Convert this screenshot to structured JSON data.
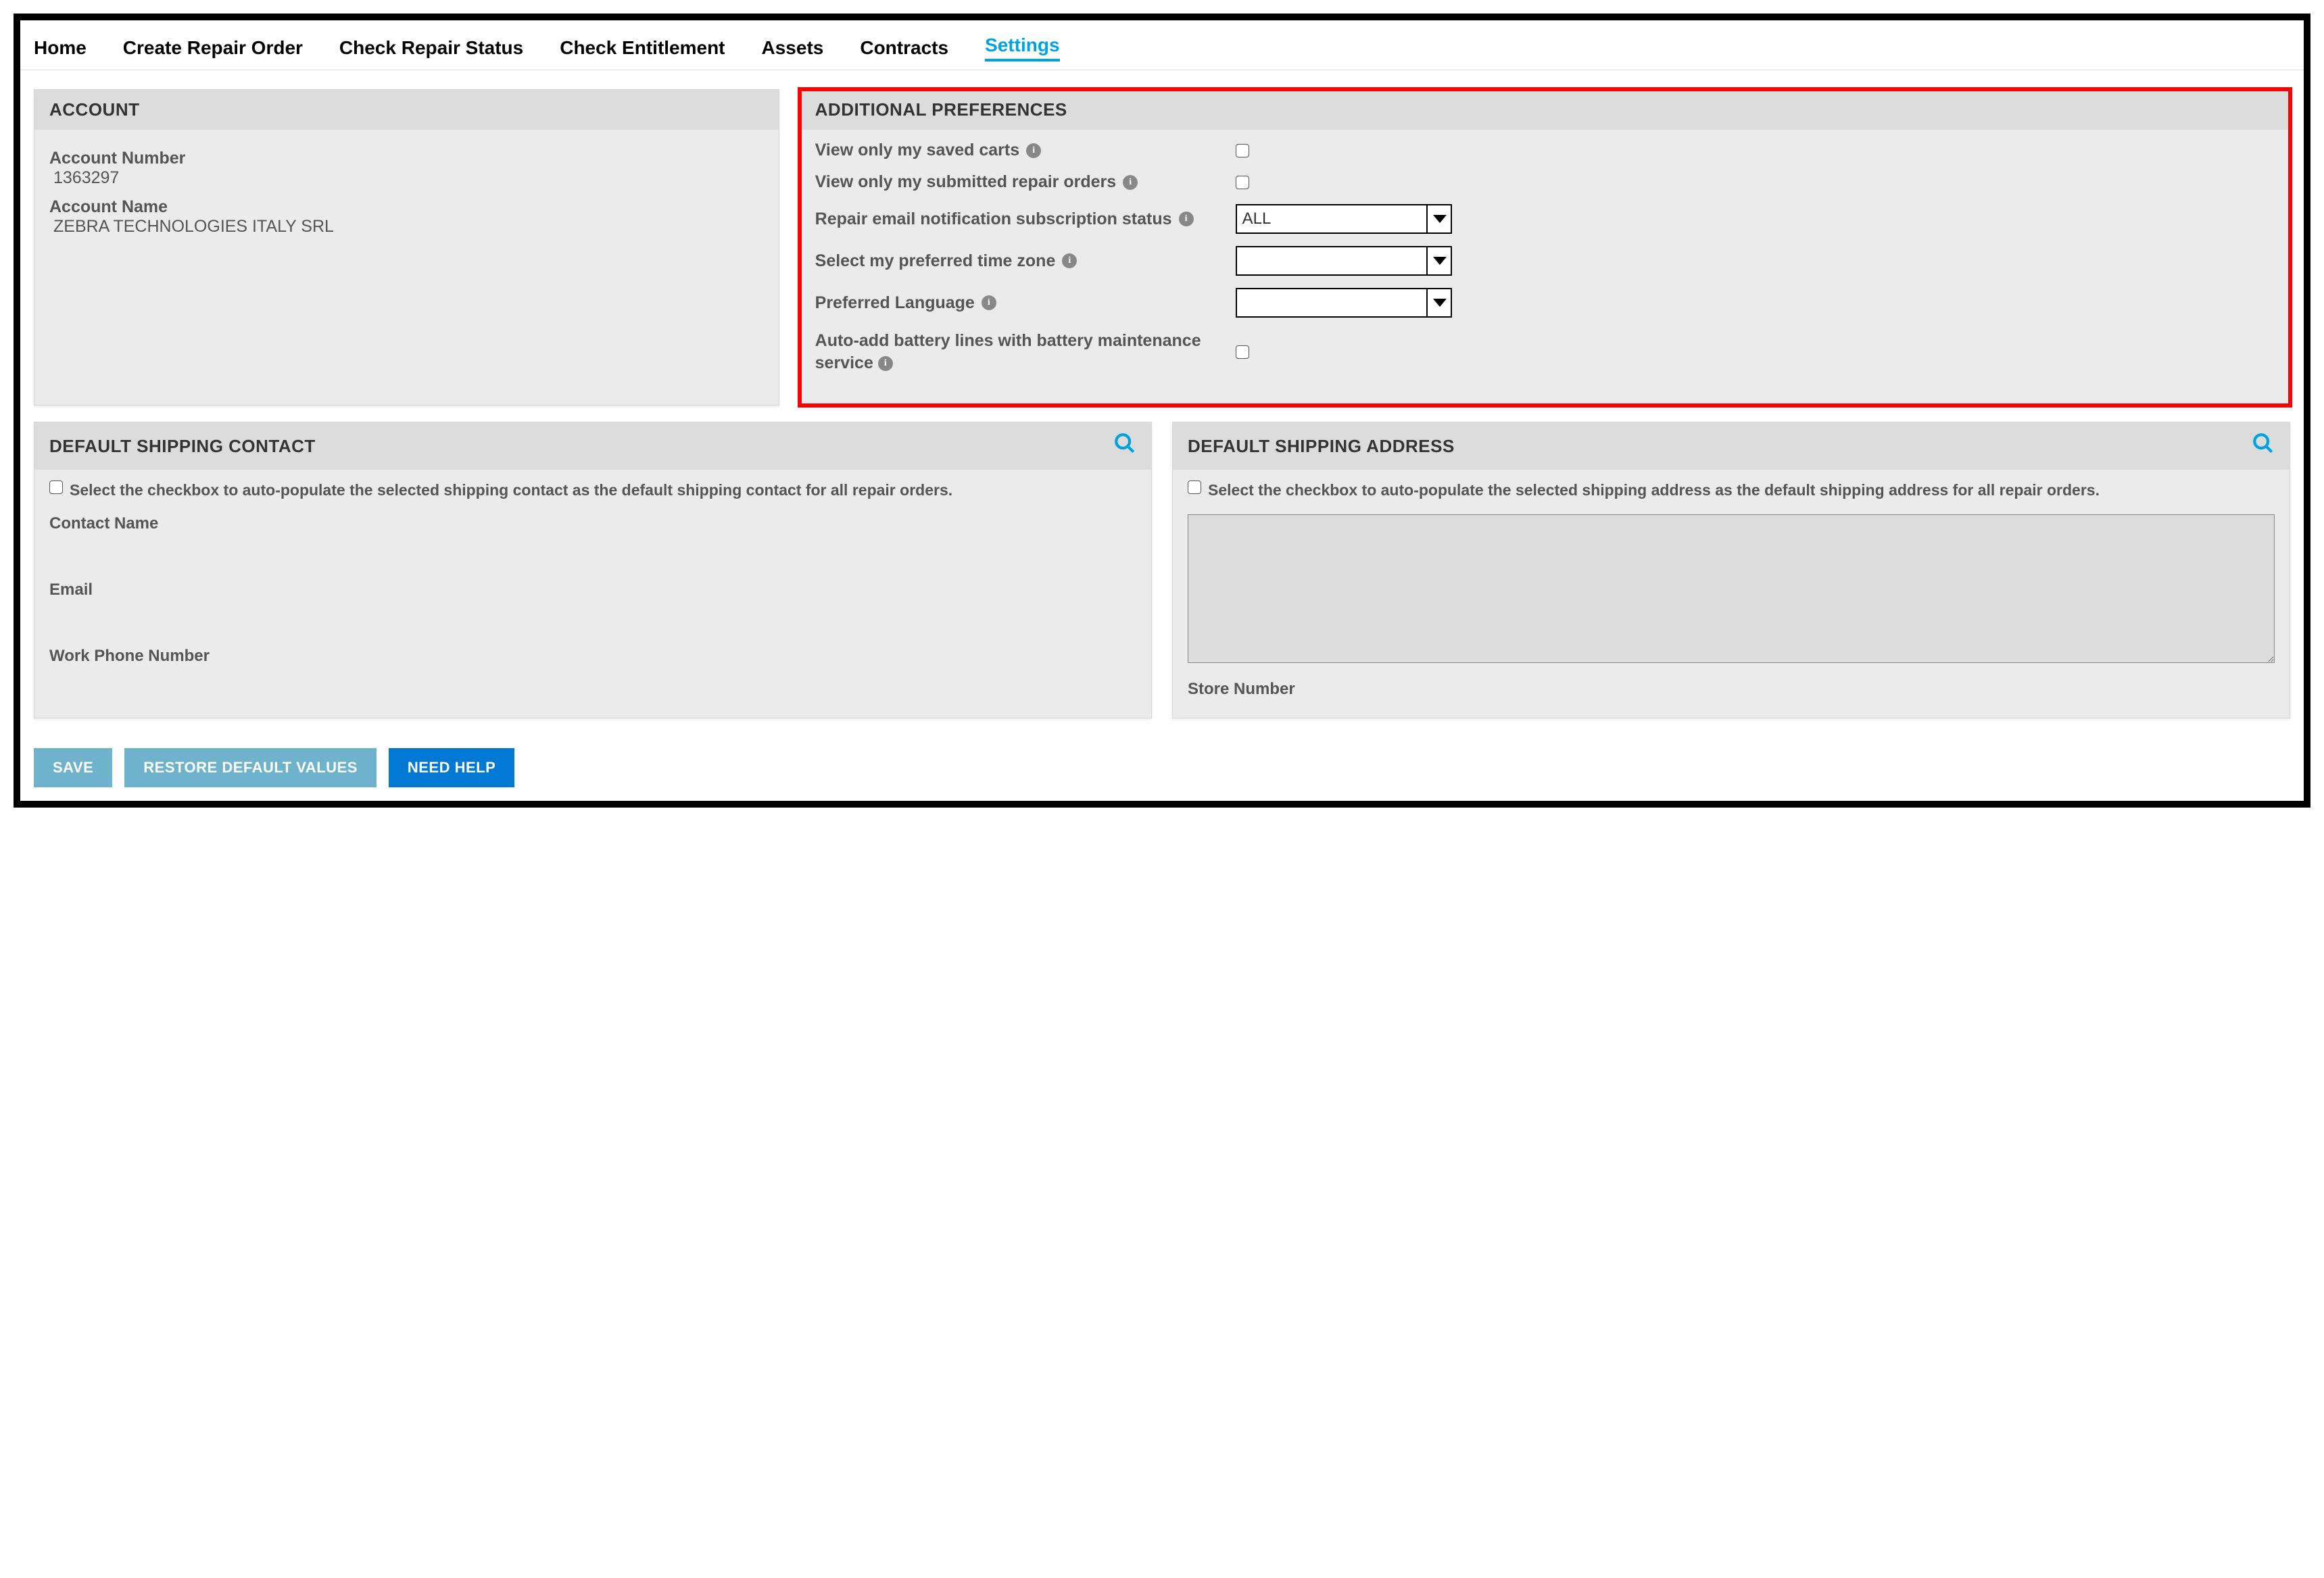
{
  "nav": {
    "items": [
      {
        "label": "Home"
      },
      {
        "label": "Create Repair Order"
      },
      {
        "label": "Check Repair Status"
      },
      {
        "label": "Check Entitlement"
      },
      {
        "label": "Assets"
      },
      {
        "label": "Contracts"
      },
      {
        "label": "Settings",
        "active": true
      }
    ]
  },
  "account": {
    "header": "ACCOUNT",
    "number_label": "Account Number",
    "number_value": "1363297",
    "name_label": "Account Name",
    "name_value": "ZEBRA TECHNOLOGIES ITALY SRL"
  },
  "prefs": {
    "header": "ADDITIONAL PREFERENCES",
    "row1": "View only my saved carts",
    "row2": "View only my submitted repair orders",
    "row3": "Repair email notification subscription status",
    "row3_value": "ALL",
    "row4": "Select my preferred time zone",
    "row4_value": "",
    "row5": "Preferred Language",
    "row5_value": "",
    "row6": "Auto-add battery lines with battery maintenance service"
  },
  "ship_contact": {
    "header": "DEFAULT SHIPPING CONTACT",
    "chk_desc": "Select the checkbox to auto-populate the selected shipping contact as the default shipping contact for all repair orders.",
    "f1": "Contact Name",
    "f2": "Email",
    "f3": "Work Phone Number"
  },
  "ship_addr": {
    "header": "DEFAULT SHIPPING ADDRESS",
    "chk_desc": "Select the checkbox to auto-populate the selected shipping address as the default shipping address for all repair orders.",
    "store": "Store Number"
  },
  "buttons": {
    "save": "SAVE",
    "restore": "RESTORE DEFAULT VALUES",
    "help": "NEED HELP"
  },
  "info_char": "i"
}
